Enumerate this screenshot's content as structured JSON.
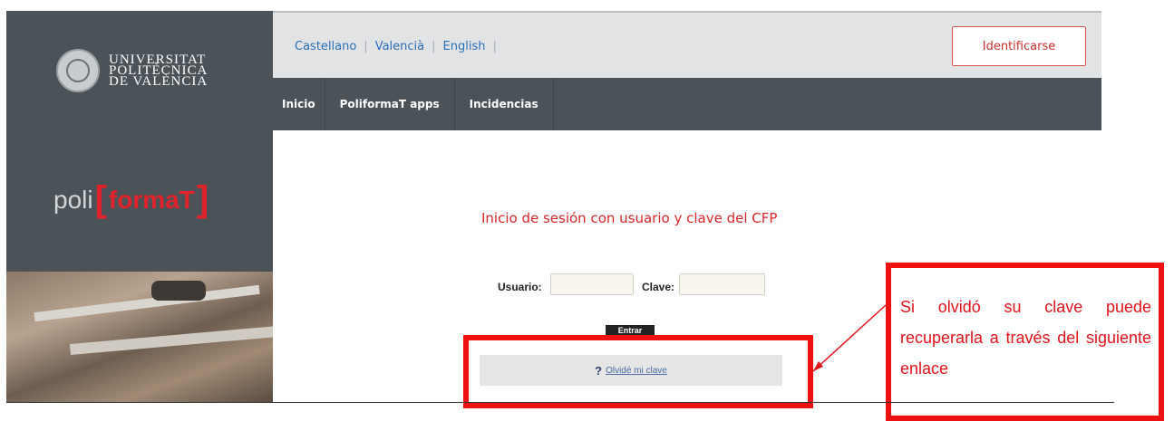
{
  "sidebar": {
    "logo_lines": [
      "UNIVERSITAT",
      "POLITÈCNICA",
      "DE VALÈNCIA"
    ],
    "brand_prefix": "poli",
    "brand_main": "formaT"
  },
  "topbar": {
    "languages": [
      "Castellano",
      "Valencià",
      "English"
    ],
    "login_button": "Identificarse"
  },
  "navbar": {
    "items": [
      "Inicio",
      "PoliformaT apps",
      "Incidencias"
    ]
  },
  "login": {
    "title": "Inicio de sesión con usuario y clave del CFP",
    "user_label": "Usuario:",
    "password_label": "Clave:",
    "submit_label": "Entrar",
    "forgot_link": "Olvidé mi clave"
  },
  "annotation": {
    "text": "Si olvidó su clave puede recuperarla a través del siguiente enlace"
  },
  "colors": {
    "accent_red": "#e2131b",
    "sidebar": "#4b5359",
    "link_blue": "#2a6fb7"
  }
}
